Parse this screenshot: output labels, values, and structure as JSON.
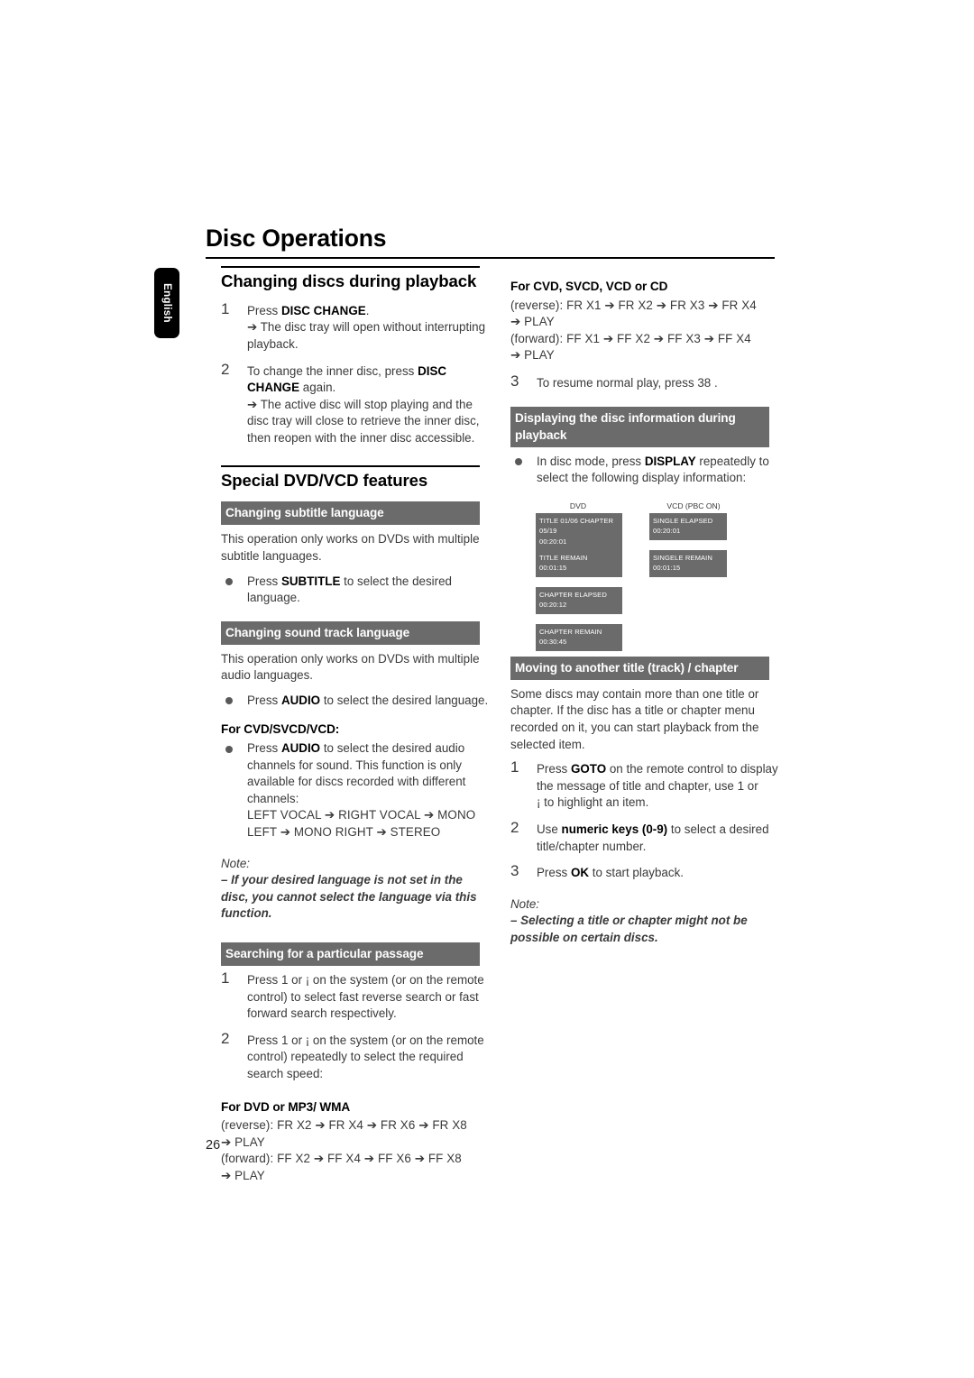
{
  "page": {
    "title": "Disc Operations",
    "language_tab": "English",
    "page_number": "26"
  },
  "left_column": {
    "section1": {
      "heading": "Changing discs during playback",
      "steps": [
        {
          "num": "1",
          "text_pre": "Press ",
          "keyword": "DISC CHANGE",
          "text_post": ".",
          "result": "➔ The disc tray will open without interrupting playback."
        },
        {
          "num": "2",
          "text_pre": "To change the inner disc, press ",
          "keyword": "DISC CHANGE",
          "text_post": " again.",
          "result": "➔ The active disc will stop playing and the disc tray will close to retrieve the inner disc, then reopen with the inner disc accessible."
        }
      ]
    },
    "section2": {
      "heading": "Special DVD/VCD features",
      "subtitle_block": {
        "bar": "Changing subtitle language",
        "body": "This operation only works on DVDs with multiple subtitle languages.",
        "bullet_pre": "Press  ",
        "bullet_kw": "SUBTITLE",
        "bullet_post": " to select the desired language."
      },
      "soundtrack_block": {
        "bar": "Changing sound track language",
        "body": "This operation only works on DVDs with multiple audio languages.",
        "bullet_pre": "Press ",
        "bullet_kw": "AUDIO",
        "bullet_post": " to select the desired language.",
        "sub_head": "For CVD/SVCD/VCD:",
        "bullet2_pre": "Press ",
        "bullet2_kw": "AUDIO",
        "bullet2_post": " to select the desired audio channels for sound. This function is  only available for discs recorded with different channels:",
        "chain1": "LEFT VOCAL ➔ RIGHT VOCAL ➔ MONO",
        "chain2": "LEFT ➔ MONO RIGHT ➔ STEREO",
        "note_title": "Note:",
        "note_body": "–  If your desired language is not set in the disc, you cannot select the language via this function."
      },
      "search_block": {
        "bar": "Searching for a particular passage",
        "steps": [
          {
            "num": "1",
            "text": "Press 1      or ¡      on the system (or on the remote control) to select fast reverse search or fast forward search respectively."
          },
          {
            "num": "2",
            "text": "Press 1      or ¡      on the system (or on the remote control) repeatedly to select the required search speed:"
          }
        ],
        "dvd_head": "For DVD or MP3/ WMA",
        "reverse": "(reverse): FR X2 ➔ FR X4 ➔ FR X6 ➔ FR X8",
        "reverse_cont": "➔ PLAY",
        "forward": "(forward): FF X2 ➔ FF X4 ➔ FF X6 ➔ FF X8",
        "forward_cont": "➔ PLAY"
      }
    }
  },
  "right_column": {
    "cvd_block": {
      "head": "For CVD, SVCD, VCD or CD",
      "reverse": "(reverse): FR X1 ➔ FR X2 ➔ FR X3 ➔ FR X4",
      "reverse_cont": "➔ PLAY",
      "forward": "(forward): FF X1 ➔ FF X2 ➔ FF X3 ➔ FF X4",
      "forward_cont": "➔ PLAY",
      "step3_num": "3",
      "step3_text": "To resume normal play, press 38 ."
    },
    "display_block": {
      "bar": "Displaying  the disc information during playback",
      "bullet_pre": "In disc mode, press ",
      "bullet_kw": "DISPLAY",
      "bullet_post": " repeatedly to select the following display information:",
      "col_head_left": "DVD",
      "col_head_right": "VCD  (PBC ON)",
      "dvd_boxes": [
        {
          "line1": "TITLE 01/06 CHAPTER 05/19",
          "line2": "00:20:01"
        },
        {
          "line1": "TITLE REMAIN",
          "line2": "00:01:15"
        },
        {
          "line1": "CHAPTER ELAPSED",
          "line2": "00:20:12"
        },
        {
          "line1": "CHAPTER REMAIN",
          "line2": "00:30:45"
        }
      ],
      "vcd_boxes": [
        {
          "line1": "SINGLE ELAPSED",
          "line2": "00:20:01"
        },
        {
          "line1": "SINGELE REMAIN",
          "line2": "00:01:15"
        }
      ]
    },
    "moving_block": {
      "bar": "Moving to another title (track) / chapter",
      "body": "Some discs may contain more than one title or chapter. If the disc has a title or chapter menu recorded on it, you can start playback from the  selected item.",
      "steps": [
        {
          "num": "1",
          "pre": "Press ",
          "kw": "GOTO",
          "post": " on the remote control to display the message of title and chapter, use 1      or",
          "cont": "¡      to highlight an item."
        },
        {
          "num": "2",
          "pre": "Use ",
          "kw": "numeric keys (0-9)",
          "post": " to select a desired title/chapter number."
        },
        {
          "num": "3",
          "pre": "Press ",
          "kw": "OK",
          "post": " to start playback."
        }
      ],
      "note_title": "Note:",
      "note_body": "–  Selecting a title or chapter might not be possible on certain discs."
    }
  }
}
